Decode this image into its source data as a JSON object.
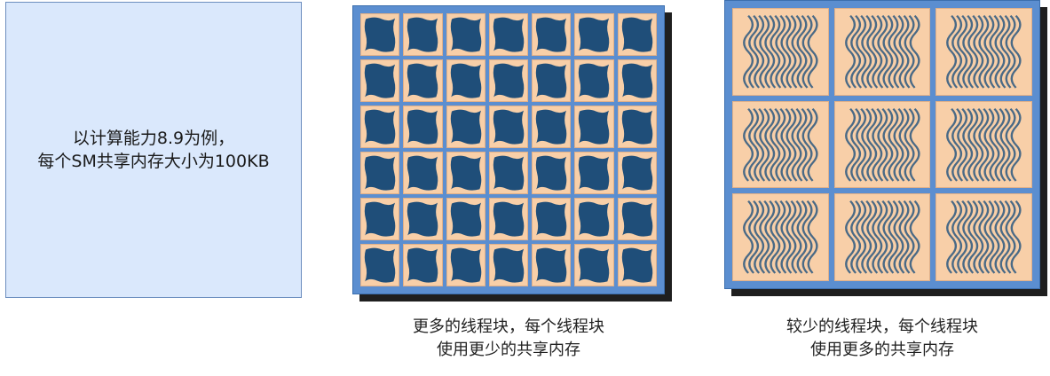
{
  "note": {
    "line1": "以计算能力8.9为例，",
    "line2": "每个SM共享内存大小为100KB"
  },
  "left_panel": {
    "rows": 6,
    "cols": 7,
    "caption_line1": "更多的线程块，每个线程块",
    "caption_line2": "使用更少的共享内存"
  },
  "right_panel": {
    "rows": 3,
    "cols": 3,
    "caption_line1": "较少的线程块，每个线程块",
    "caption_line2": "使用更多的共享内存"
  },
  "colors": {
    "note_fill": "#dae8fc",
    "note_stroke": "#6c8ebf",
    "grid_frame": "#5b8ed0",
    "cell_fill": "#f8cfa8",
    "block_fill": "#1f4e79",
    "wave_stroke": "#4a6a86"
  },
  "icons": {
    "small_block": "thread-block-icon",
    "large_block": "thread-waves-icon"
  }
}
